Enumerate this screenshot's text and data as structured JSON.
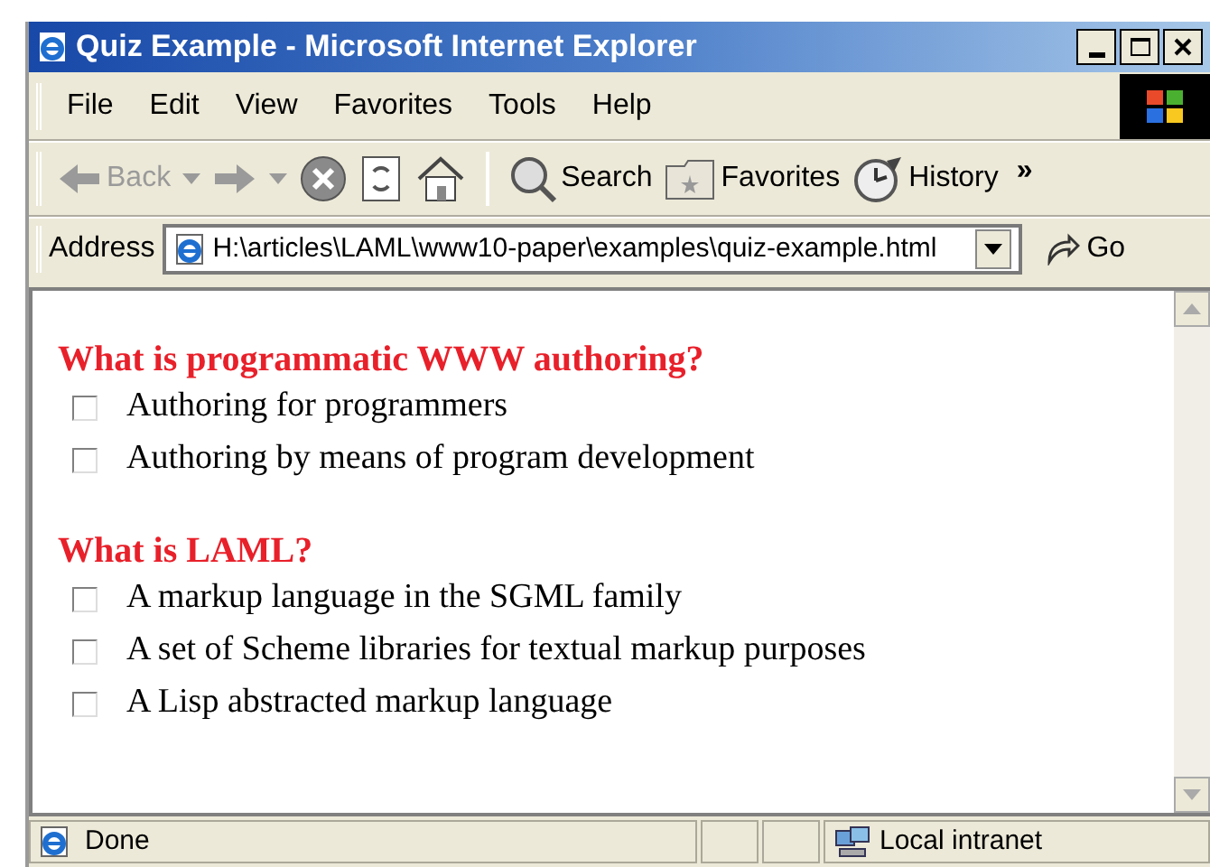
{
  "window": {
    "title": "Quiz Example - Microsoft Internet Explorer"
  },
  "menu": [
    "File",
    "Edit",
    "View",
    "Favorites",
    "Tools",
    "Help"
  ],
  "toolbar": [
    {
      "kind": "back",
      "label": "Back",
      "disabled": true
    },
    {
      "kind": "forward",
      "disabled": true
    },
    {
      "kind": "stop"
    },
    {
      "kind": "refresh"
    },
    {
      "kind": "home"
    },
    {
      "kind": "search",
      "label": "Search"
    },
    {
      "kind": "favorites",
      "label": "Favorites"
    },
    {
      "kind": "history",
      "label": "History"
    }
  ],
  "toolbar_more": "»",
  "address": {
    "label": "Address",
    "value": "H:\\articles\\LAML\\www10-paper\\examples\\quiz-example.html",
    "go": "Go"
  },
  "questions": [
    {
      "text": "What is programmatic WWW authoring?",
      "options": [
        {
          "label": "Authoring for programmers",
          "checked": false
        },
        {
          "label": "Authoring by means of program development",
          "checked": false
        }
      ]
    },
    {
      "text": "What is LAML?",
      "options": [
        {
          "label": "A markup language in the SGML family",
          "checked": false
        },
        {
          "label": "A set of Scheme libraries for textual markup purposes",
          "checked": false
        },
        {
          "label": "A Lisp abstracted markup language",
          "checked": false
        }
      ]
    }
  ],
  "status_bar": {
    "text": "Done",
    "zone": "Local intranet"
  }
}
